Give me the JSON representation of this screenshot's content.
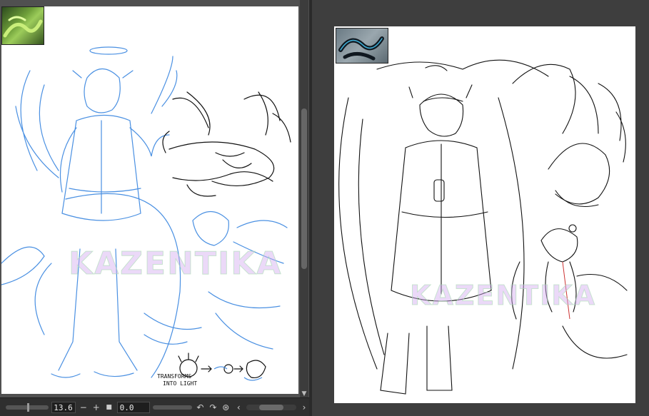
{
  "left_view": {
    "watermark": "KAZENTIKA",
    "caption_line1": "TRANSFORMS",
    "caption_line2": "INTO LIGHT",
    "reference_thumb_icon": "green-snake-photo-icon"
  },
  "right_view": {
    "watermark": "KAZENTIKA",
    "reference_thumb_icon": "black-snake-photo-icon"
  },
  "statusbar": {
    "zoom_value": "13.6",
    "zoom_out_icon": "−",
    "zoom_in_icon": "+",
    "fit_icon": "■",
    "rotation_value": "0.0",
    "rotate_left_icon": "↶",
    "rotate_right_icon": "↷",
    "reset_icon": "⊛",
    "scroll_left_icon": "‹",
    "scroll_right_icon": "›"
  },
  "colors": {
    "sketch_blue": "#4a90e2",
    "line_black": "#111111",
    "accent_red": "#cc3333"
  }
}
